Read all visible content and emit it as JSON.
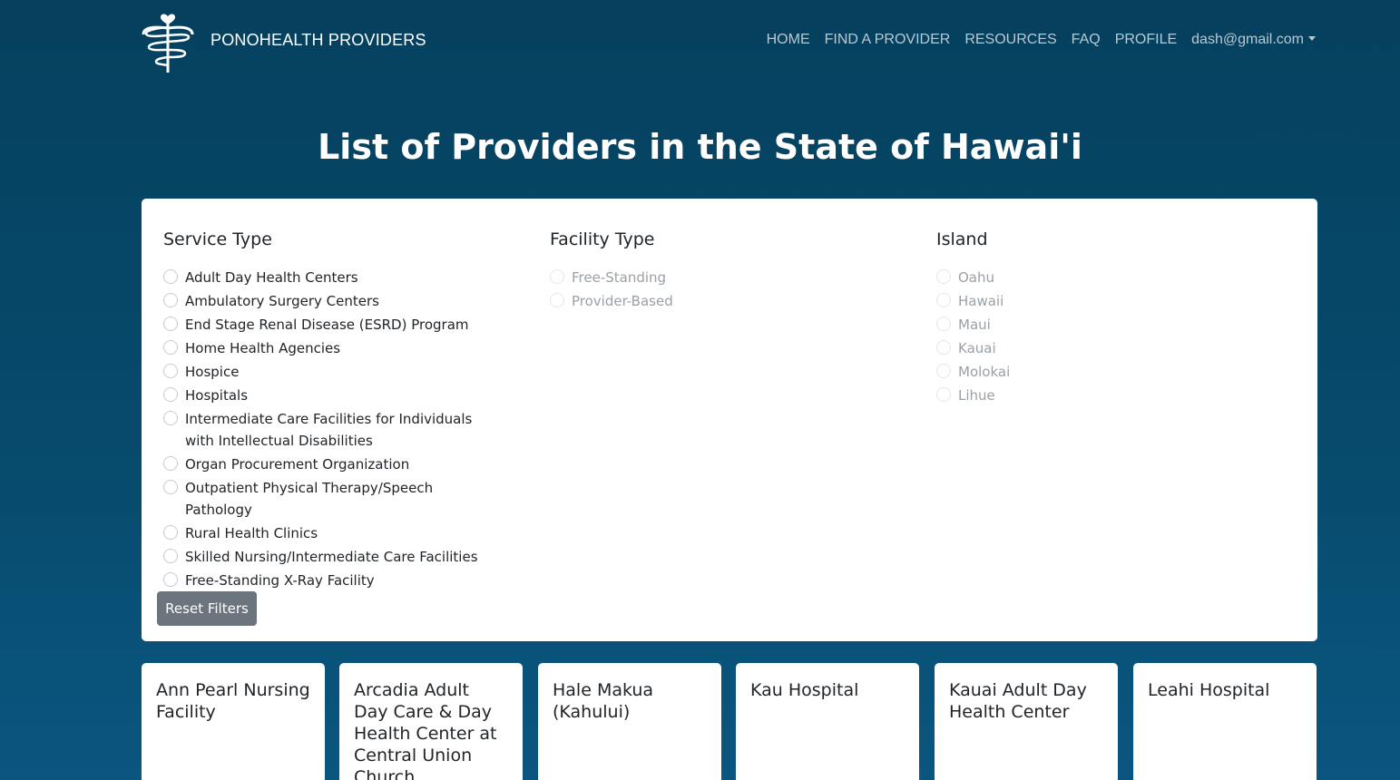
{
  "navbar": {
    "brand": "PONOHEALTH PROVIDERS",
    "links": [
      "HOME",
      "FIND A PROVIDER",
      "RESOURCES",
      "FAQ",
      "PROFILE"
    ],
    "user_email": "dash@gmail.com"
  },
  "page_title": "List of Providers in the State of Hawai'i",
  "filters": {
    "service_type": {
      "heading": "Service Type",
      "options": [
        "Adult Day Health Centers",
        "Ambulatory Surgery Centers",
        "End Stage Renal Disease (ESRD) Program",
        "Home Health Agencies",
        "Hospice",
        "Hospitals",
        "Intermediate Care Facilities for Individuals with Intellectual Disabilities",
        "Organ Procurement Organization",
        "Outpatient Physical Therapy/Speech Pathology",
        "Rural Health Clinics",
        "Skilled Nursing/Intermediate Care Facilities",
        "Free-Standing X-Ray Facility"
      ]
    },
    "facility_type": {
      "heading": "Facility Type",
      "options": [
        "Free-Standing",
        "Provider-Based"
      ]
    },
    "island": {
      "heading": "Island",
      "options": [
        "Oahu",
        "Hawaii",
        "Maui",
        "Kauai",
        "Molokai",
        "Lihue"
      ]
    },
    "reset_label": "Reset Filters"
  },
  "providers": [
    "Ann Pearl Nursing Facility",
    "Arcadia Adult Day Care & Day Health Center at Central Union Church",
    "Hale Makua (Kahului)",
    "Kau Hospital",
    "Kauai Adult Day Health Center",
    "Leahi Hospital"
  ],
  "colors": {
    "background": "#05405e",
    "card": "#ffffff",
    "reset_button": "#6c757d",
    "nav_link": "#b9c9d3"
  }
}
